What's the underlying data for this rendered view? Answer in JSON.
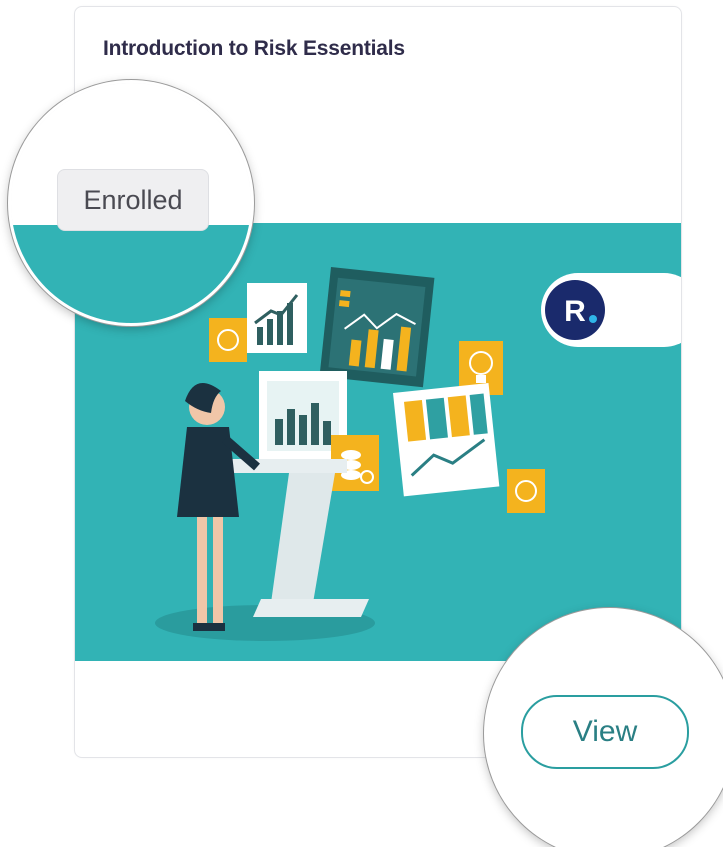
{
  "card": {
    "title": "Introduction to Risk Essentials",
    "status_badge": "Enrolled",
    "view_label": "View",
    "logo_letter": "R"
  },
  "colors": {
    "hero_background": "#32b3b5",
    "accent": "#2a9ea0",
    "title_text": "#2f2c4a",
    "badge_background": "#efeff1",
    "logo_background": "#1a2a6c"
  },
  "icons": [
    "chart-screen-icon",
    "lightbulb-icon",
    "coins-icon",
    "globe-icon"
  ]
}
